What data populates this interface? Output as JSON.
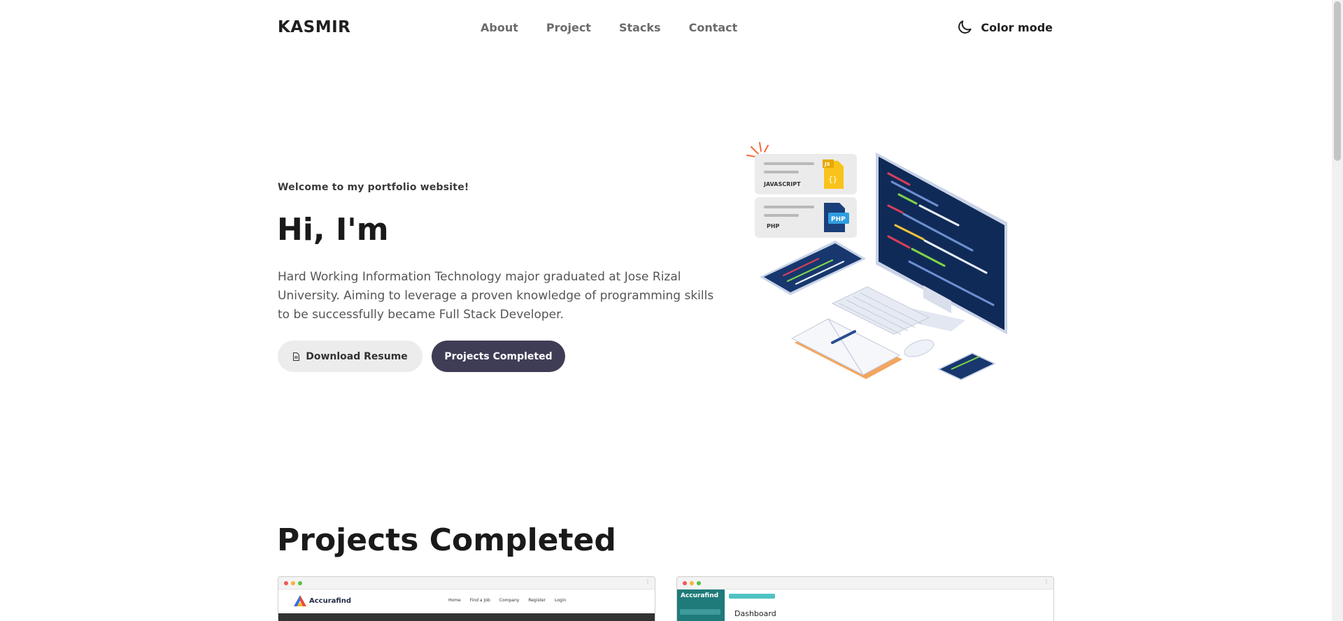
{
  "nav": {
    "brand": "KASMIR",
    "links": [
      "About",
      "Project",
      "Stacks",
      "Contact"
    ],
    "color_mode_label": "Color mode"
  },
  "hero": {
    "welcome": "Welcome to my portfolio website!",
    "title": "Hi, I'm",
    "description": "Hard Working Information Technology major graduated at Jose Rizal University. Aiming to leverage a proven knowledge of programming skills to be successfully became Full Stack Developer.",
    "download_label": "Download Resume",
    "projects_label": "Projects Completed",
    "illustration": {
      "card_js_label": "JAVASCRIPT",
      "card_js_badge": "JS",
      "card_php_label": "PHP",
      "card_php_badge": "PHP"
    }
  },
  "projects": {
    "section_title": "Projects Completed",
    "cards": [
      {
        "brand": "Accurafind",
        "nav": [
          "Home",
          "Find a Job",
          "Company",
          "Register",
          "Login"
        ]
      },
      {
        "brand": "Accurafind",
        "title": "Dashboard"
      }
    ]
  },
  "colors": {
    "primary_button": "#3f3d56",
    "secondary_button": "#ececec",
    "text_dark": "#1a1a1a",
    "text_muted": "#555555"
  }
}
